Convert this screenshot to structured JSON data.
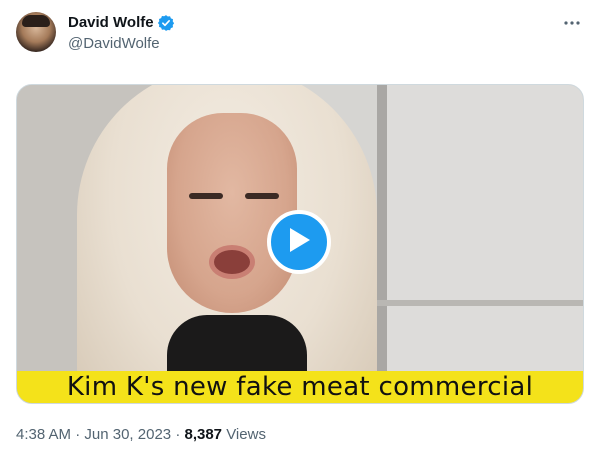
{
  "author": {
    "display_name": "David Wolfe",
    "handle": "@DavidWolfe",
    "verified": true
  },
  "media": {
    "caption": "Kim K's new fake meat commercial",
    "type": "video"
  },
  "meta": {
    "time": "4:38 AM",
    "separator": "·",
    "date": "Jun 30, 2023",
    "views_count": "8,387",
    "views_label": "Views"
  },
  "colors": {
    "accent": "#1d9bf0",
    "caption_band": "#f4e21a",
    "secondary_text": "#536471"
  },
  "icons": {
    "verified": "verified-badge-icon",
    "more": "more-dots-icon",
    "play": "play-icon"
  }
}
